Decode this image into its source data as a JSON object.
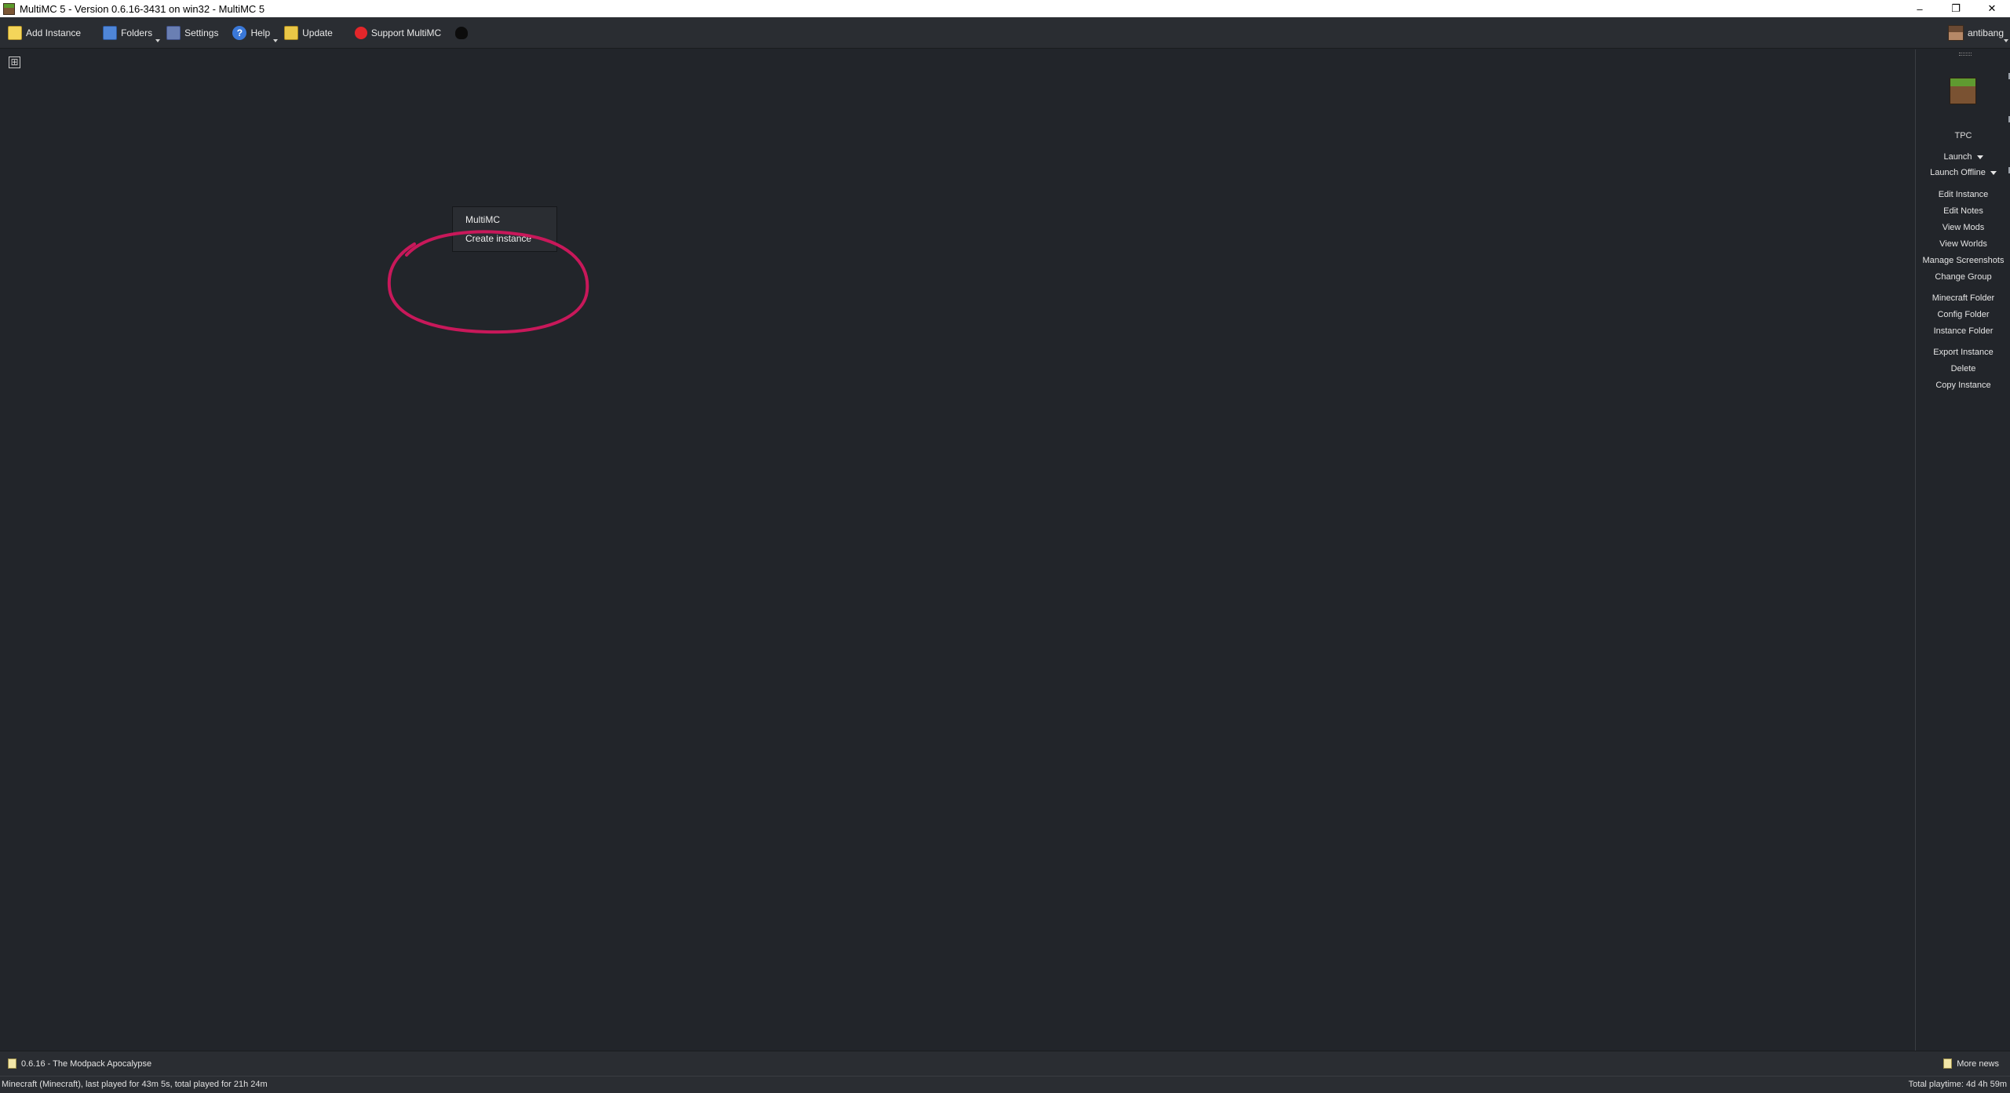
{
  "window": {
    "title": "MultiMC 5 - Version 0.6.16-3431 on win32 - MultiMC 5",
    "controls": {
      "minimize": "–",
      "maximize": "❐",
      "close": "✕"
    }
  },
  "toolbar": {
    "add_instance": "Add Instance",
    "folders": "Folders",
    "settings": "Settings",
    "help": "Help",
    "update": "Update",
    "support": "Support MultiMC",
    "account": "antibang"
  },
  "context_menu": {
    "items": [
      "MultiMC",
      "Create instance"
    ]
  },
  "annotation": {
    "color": "#c8185a"
  },
  "instance_panel": {
    "name": "TPC",
    "launch": "Launch",
    "launch_offline": "Launch Offline",
    "actions": [
      "Edit Instance",
      "Edit Notes",
      "View Mods",
      "View Worlds",
      "Manage Screenshots",
      "Change Group",
      "Minecraft Folder",
      "Config Folder",
      "Instance Folder",
      "Export Instance",
      "Delete",
      "Copy Instance"
    ]
  },
  "news": {
    "headline": "0.6.16 - The Modpack Apocalypse",
    "more": "More news"
  },
  "status": {
    "left": "Minecraft  (Minecraft), last played for 43m 5s, total played for 21h 24m",
    "right": "Total playtime: 4d 4h 59m"
  }
}
